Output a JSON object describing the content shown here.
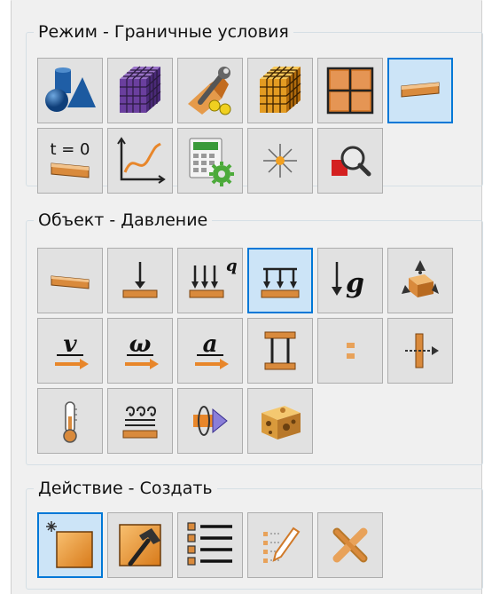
{
  "mode_group": {
    "title": "Режим - Граничные условия",
    "buttons": [
      {
        "icon": "geometry-icon",
        "selected": false
      },
      {
        "icon": "mesh-cube-icon",
        "selected": false
      },
      {
        "icon": "material-wrench-icon",
        "selected": false
      },
      {
        "icon": "structured-mesh-icon",
        "selected": false
      },
      {
        "icon": "grid-frame-icon",
        "selected": false
      },
      {
        "icon": "boundary-conditions-icon",
        "selected": true
      },
      {
        "icon": "initial-conditions-icon",
        "label": "t = 0",
        "selected": false
      },
      {
        "icon": "chart-curve-icon",
        "selected": false
      },
      {
        "icon": "calculator-gear-icon",
        "selected": false
      },
      {
        "icon": "results-burst-icon",
        "selected": false
      },
      {
        "icon": "magnifier-inspect-icon",
        "selected": false
      }
    ]
  },
  "object_group": {
    "title": "Объект - Давление",
    "buttons": [
      {
        "icon": "surface-icon",
        "selected": false
      },
      {
        "icon": "force-icon",
        "selected": false
      },
      {
        "icon": "distributed-load-q-icon",
        "label": "q",
        "selected": false
      },
      {
        "icon": "pressure-icon",
        "selected": true
      },
      {
        "icon": "gravity-icon",
        "label": "g",
        "selected": false
      },
      {
        "icon": "support-constraint-icon",
        "selected": false
      },
      {
        "icon": "velocity-icon",
        "label": "v",
        "selected": false
      },
      {
        "icon": "angular-velocity-icon",
        "label": "ω",
        "selected": false
      },
      {
        "icon": "acceleration-icon",
        "label": "a",
        "selected": false
      },
      {
        "icon": "rigid-link-icon",
        "selected": false
      },
      {
        "icon": "gap-contact-icon",
        "selected": false
      },
      {
        "icon": "displacement-arrow-icon",
        "selected": false
      },
      {
        "icon": "temperature-icon",
        "selected": false
      },
      {
        "icon": "heat-flux-icon",
        "selected": false
      },
      {
        "icon": "rotation-arrow-icon",
        "selected": false
      },
      {
        "icon": "volume-cheese-icon",
        "selected": false
      }
    ]
  },
  "action_group": {
    "title": "Действие - Создать",
    "buttons": [
      {
        "icon": "create-new-icon",
        "selected": true
      },
      {
        "icon": "hammer-edit-icon",
        "selected": false
      },
      {
        "icon": "list-icon",
        "selected": false
      },
      {
        "icon": "pencil-list-icon",
        "selected": false
      },
      {
        "icon": "delete-cross-icon",
        "selected": false
      }
    ]
  },
  "colors": {
    "selection_fill": "#cce4f7",
    "selection_border": "#0078d7",
    "button_fill": "#e1e1e1",
    "orange_accent": "#e8924a",
    "blue_accent": "#2a6fb3"
  }
}
